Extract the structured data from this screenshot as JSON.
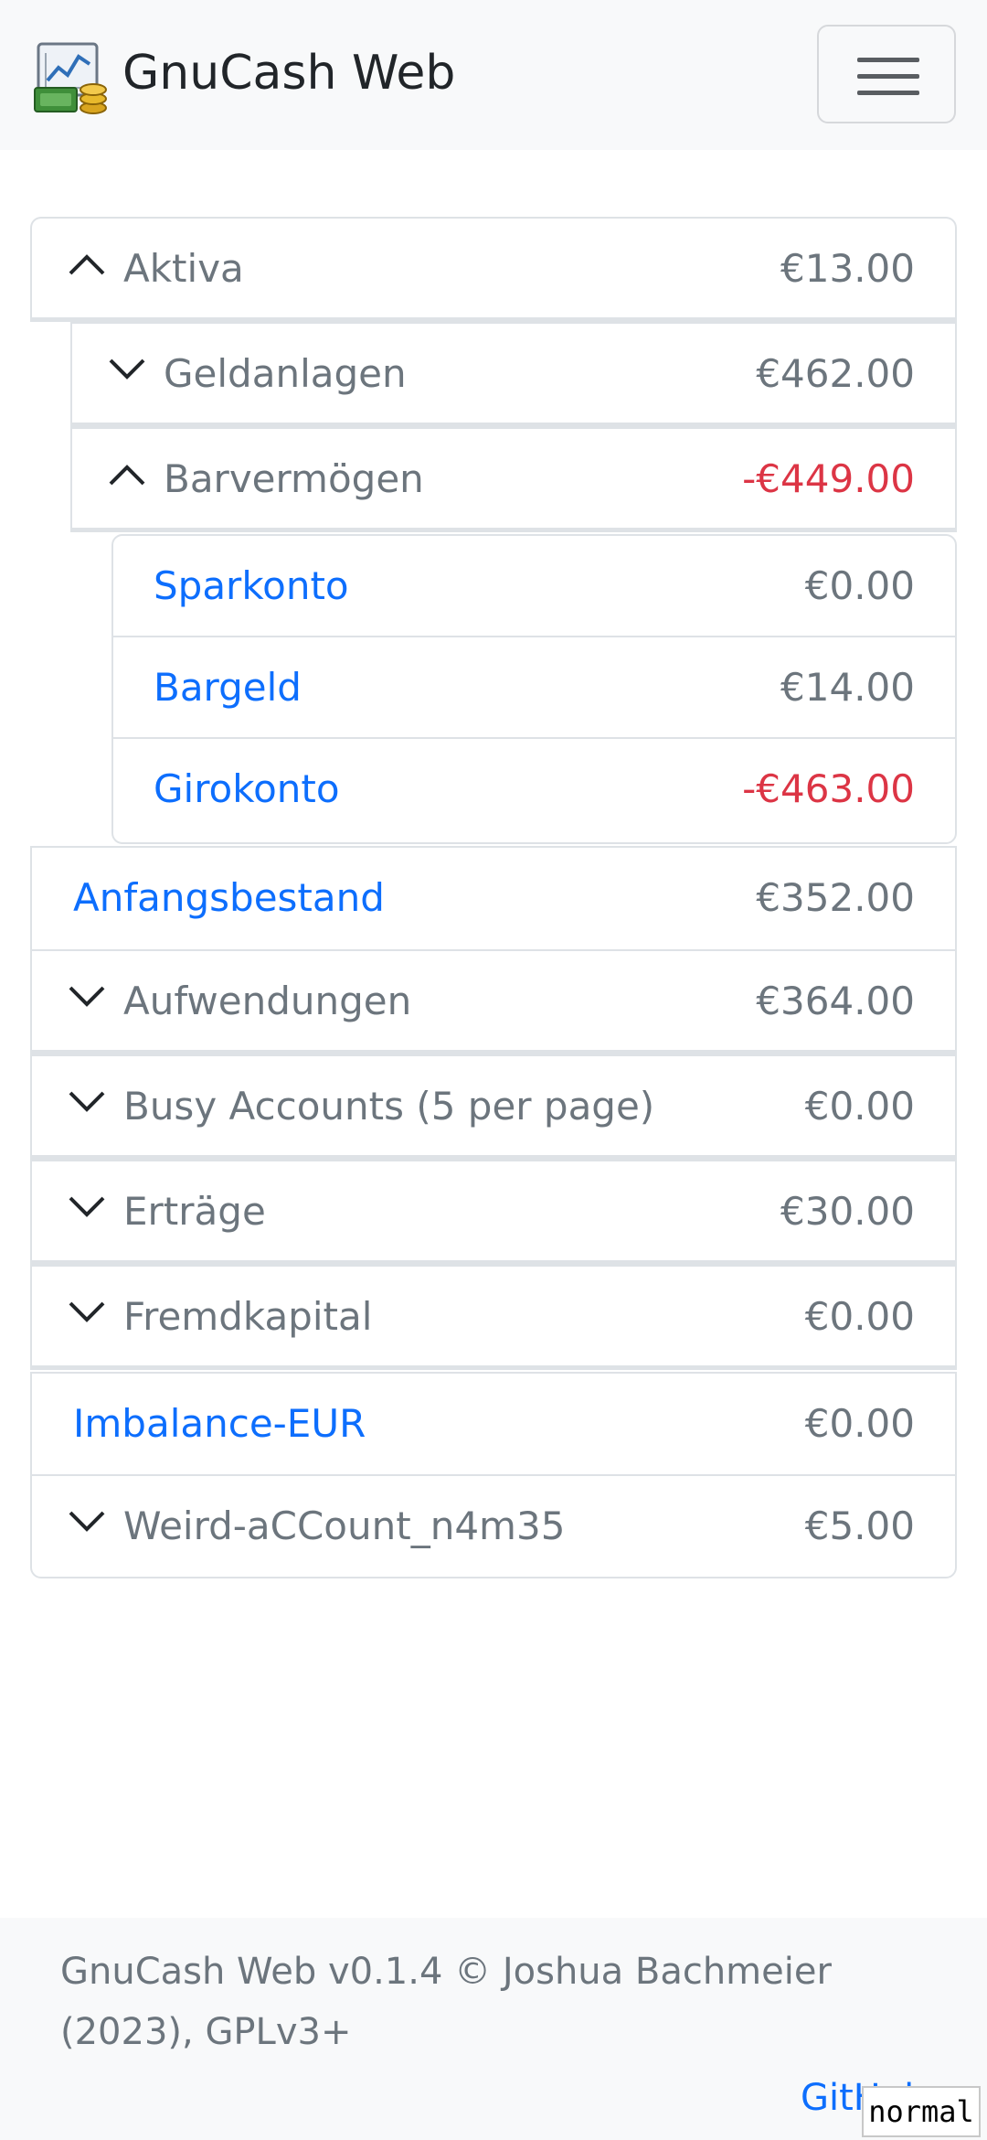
{
  "navbar": {
    "brand": "GnuCash Web",
    "logo_icon": "gnucash-logo-icon",
    "menu_icon": "hamburger-menu-icon"
  },
  "accounts": {
    "aktiva": {
      "name": "Aktiva",
      "amount": "€13.00",
      "expanded": true
    },
    "geldanlagen": {
      "name": "Geldanlagen",
      "amount": "€462.00",
      "expanded": false
    },
    "barvermoegen": {
      "name": "Barvermögen",
      "amount": "-€449.00",
      "expanded": true
    },
    "sparkonto": {
      "name": "Sparkonto",
      "amount": "€0.00"
    },
    "bargeld": {
      "name": "Bargeld",
      "amount": "€14.00"
    },
    "girokonto": {
      "name": "Girokonto",
      "amount": "-€463.00"
    },
    "anfangsbestand": {
      "name": "Anfangsbestand",
      "amount": "€352.00"
    },
    "aufwendungen": {
      "name": "Aufwendungen",
      "amount": "€364.00",
      "expanded": false
    },
    "busy_accounts": {
      "name": "Busy Accounts (5 per page)",
      "amount": "€0.00",
      "expanded": false
    },
    "ertraege": {
      "name": "Erträge",
      "amount": "€30.00",
      "expanded": false
    },
    "fremdkapital": {
      "name": "Fremdkapital",
      "amount": "€0.00",
      "expanded": false
    },
    "imbalance": {
      "name": "Imbalance-EUR",
      "amount": "€0.00"
    },
    "weird": {
      "name": "Weird-aCCount_n4m35",
      "amount": "€5.00",
      "expanded": false
    }
  },
  "footer": {
    "text": "GnuCash Web v0.1.4 © Joshua Bachmeier (2023), GPLv3+",
    "link": "GitHub"
  },
  "mode_badge": "normal",
  "colors": {
    "link": "#0d6efd",
    "negative": "#dc3545",
    "muted": "#6c757d",
    "border": "#dee2e6",
    "navbar_bg": "#f8f9fa"
  }
}
